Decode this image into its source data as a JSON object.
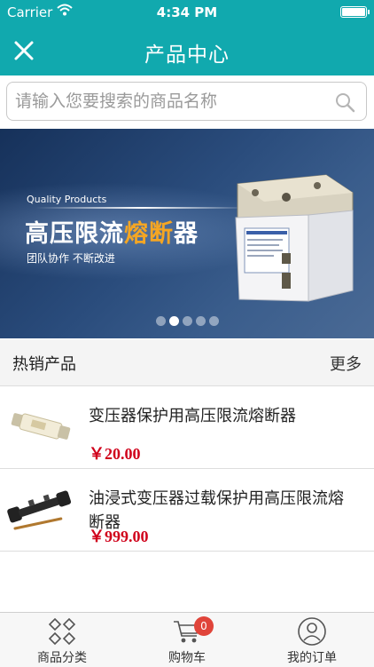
{
  "status_bar": {
    "carrier": "Carrier",
    "time": "4:34 PM"
  },
  "nav": {
    "title": "产品中心",
    "close_icon": "close-icon"
  },
  "search": {
    "placeholder": "请输入您要搜索的商品名称",
    "value": "",
    "icon": "search-icon"
  },
  "banner": {
    "tagline": "Quality Products",
    "headline_part1": "高压限流",
    "headline_highlight": "熔断",
    "headline_part2": "器",
    "subtitle": "团队协作  不断改进",
    "slides_total": 5,
    "active_slide": 2,
    "highlight_color": "#f5a623"
  },
  "section": {
    "title": "热销产品",
    "more_label": "更多"
  },
  "products": [
    {
      "name": "变压器保护用高压限流熔断器",
      "price": "￥20.00"
    },
    {
      "name": "油浸式变压器过载保护用高压限流熔断器",
      "price": "￥999.00"
    }
  ],
  "tabbar": {
    "tabs": [
      {
        "label": "商品分类",
        "icon": "grid-icon"
      },
      {
        "label": "购物车",
        "icon": "cart-icon",
        "badge": "0"
      },
      {
        "label": "我的订单",
        "icon": "user-icon"
      }
    ]
  },
  "colors": {
    "header": "#11a9ae",
    "price": "#d0021b",
    "badge": "#e0443a"
  }
}
